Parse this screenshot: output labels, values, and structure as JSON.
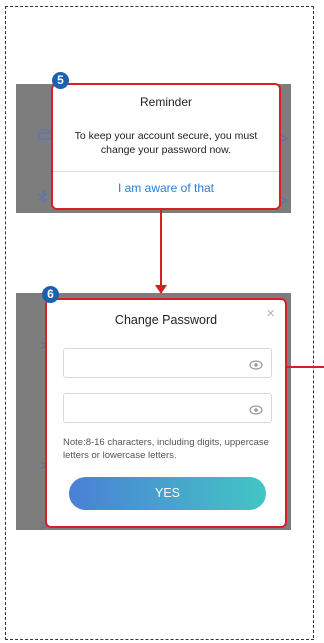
{
  "steps": {
    "step5": "5",
    "step6": "6"
  },
  "reminder_dialog": {
    "title": "Reminder",
    "message": "To keep your account secure, you must change your password  now.",
    "button_label": "I am aware of that"
  },
  "change_password_dialog": {
    "title": "Change Password",
    "close_label": "×",
    "password_field_1": {
      "value": "",
      "placeholder": ""
    },
    "password_field_2": {
      "value": "",
      "placeholder": ""
    },
    "note": "Note:8-16 characters, including digits, uppercase letters or lowercase letters.",
    "confirm_label": "YES"
  },
  "background_panels": {
    "chevron": ">"
  },
  "colors": {
    "highlight": "#d71f28",
    "step_badge": "#1d5fb0",
    "link": "#2c7fd0",
    "button_gradient_start": "#4b7fd6",
    "button_gradient_end": "#43c6c4"
  },
  "icons": [
    "eye-icon",
    "close-icon",
    "printer-icon",
    "bluetooth-icon",
    "chevron-right-icon"
  ]
}
